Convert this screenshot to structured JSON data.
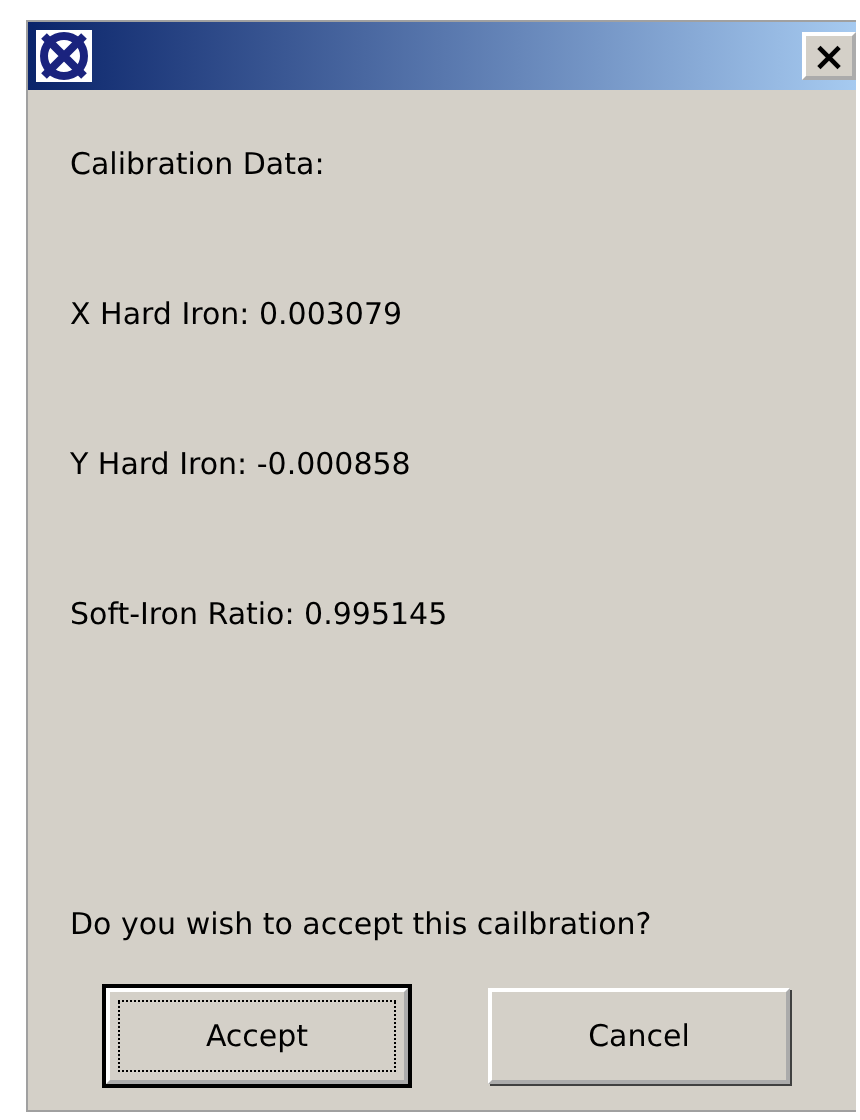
{
  "window": {
    "close_label": "×"
  },
  "lines": [
    "Calibration Data:",
    "X Hard Iron: 0.003079",
    "Y Hard Iron: -0.000858",
    "Soft-Iron Ratio: 0.995145"
  ],
  "question": "Do you wish to accept this cailbration?",
  "buttons": [
    {
      "label": "Accept",
      "focused": true
    },
    {
      "label": "Cancel",
      "focused": false
    }
  ]
}
